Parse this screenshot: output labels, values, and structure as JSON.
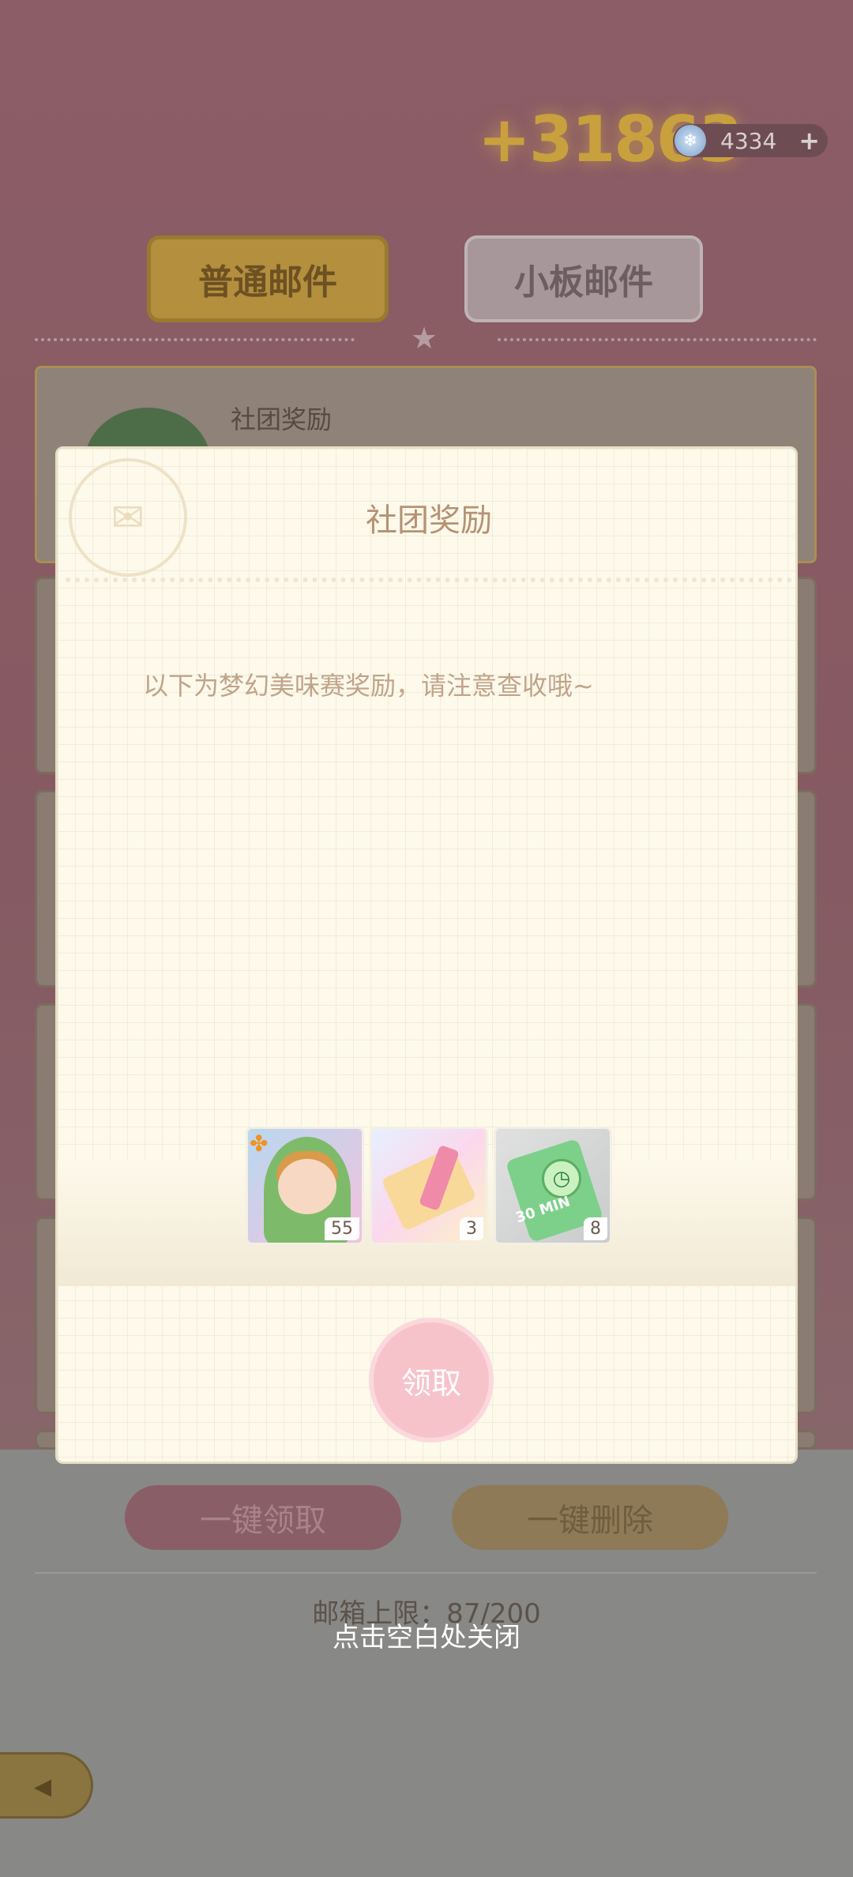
{
  "header": {
    "score": "+31863",
    "currency_amount": "4334",
    "currency_icon": "gem-icon",
    "currency_add_label": "+"
  },
  "tabs": [
    {
      "label": "普通邮件",
      "active": true
    },
    {
      "label": "小板邮件",
      "active": false
    }
  ],
  "mail_list": {
    "first_item_title": "社团奖励"
  },
  "footer": {
    "claim_all_label": "一键领取",
    "delete_all_label": "一键删除",
    "mailbox_limit": "邮箱上限：87/200",
    "close_hint": "点击空白处关闭"
  },
  "modal": {
    "title": "社团奖励",
    "body": "以下为梦幻美味赛奖励，请注意查收哦~",
    "rewards": [
      {
        "name": "frog-costume-character",
        "count": "55"
      },
      {
        "name": "pink-ticket-with-pen",
        "count": "3"
      },
      {
        "name": "30-min-time-ticket",
        "count": "8",
        "label": "30 MIN"
      }
    ],
    "claim_label": "领取"
  },
  "colors": {
    "accent_gold": "#b38f3e",
    "claim_pink": "#f7c3cb",
    "modal_bg": "#fdf9eb",
    "title_brown": "#b59273"
  }
}
